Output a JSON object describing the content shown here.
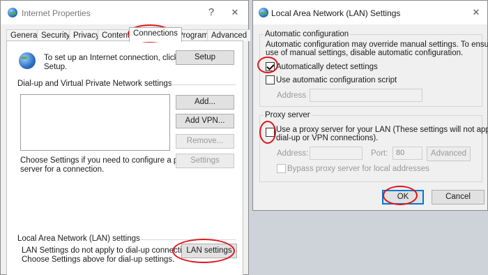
{
  "internet_properties": {
    "title": "Internet Properties",
    "help_label": "?",
    "close_label": "✕",
    "tabs": [
      "General",
      "Security",
      "Privacy",
      "Content",
      "Connections",
      "Programs",
      "Advanced"
    ],
    "active_tab": "Connections",
    "setup_text": "To set up an Internet connection, click Setup.",
    "setup_line1": "To set up an Internet connection, click",
    "setup_line2": "Setup.",
    "setup_button": "Setup",
    "dialup_heading": "Dial-up and Virtual Private Network settings",
    "add_button": "Add...",
    "add_vpn_button": "Add VPN...",
    "remove_button": "Remove...",
    "choose_line1": "Choose Settings if you need to configure a proxy",
    "choose_line2": "server for a connection.",
    "settings_button": "Settings",
    "lan_heading": "Local Area Network (LAN) settings",
    "lan_line1": "LAN Settings do not apply to dial-up connections.",
    "lan_line2": "Choose Settings above for dial-up settings.",
    "lan_settings_button": "LAN settings"
  },
  "lan_dialog": {
    "title": "Local Area Network (LAN) Settings",
    "close_label": "✕",
    "auto_config_heading": "Automatic configuration",
    "auto_config_line1": "Automatic configuration may override manual settings.  To ensure the",
    "auto_config_line2": "use of manual settings, disable automatic configuration.",
    "auto_detect_label": "Automatically detect settings",
    "auto_detect_checked": true,
    "use_script_label": "Use automatic configuration script",
    "use_script_checked": false,
    "address_label": "Address",
    "address_value": "",
    "proxy_heading": "Proxy server",
    "proxy_line1": "Use a proxy server for your LAN (These settings will not apply to",
    "proxy_line2": "dial-up or VPN connections).",
    "proxy_checked": false,
    "proxy_address_label": "Address:",
    "proxy_address_value": "",
    "port_label": "Port:",
    "port_value": "80",
    "advanced_button": "Advanced",
    "bypass_label": "Bypass proxy server for local addresses",
    "bypass_checked": false,
    "ok_button": "OK",
    "cancel_button": "Cancel"
  },
  "colors": {
    "annotation_red": "#e0141b",
    "focus_blue": "#0078d7"
  }
}
